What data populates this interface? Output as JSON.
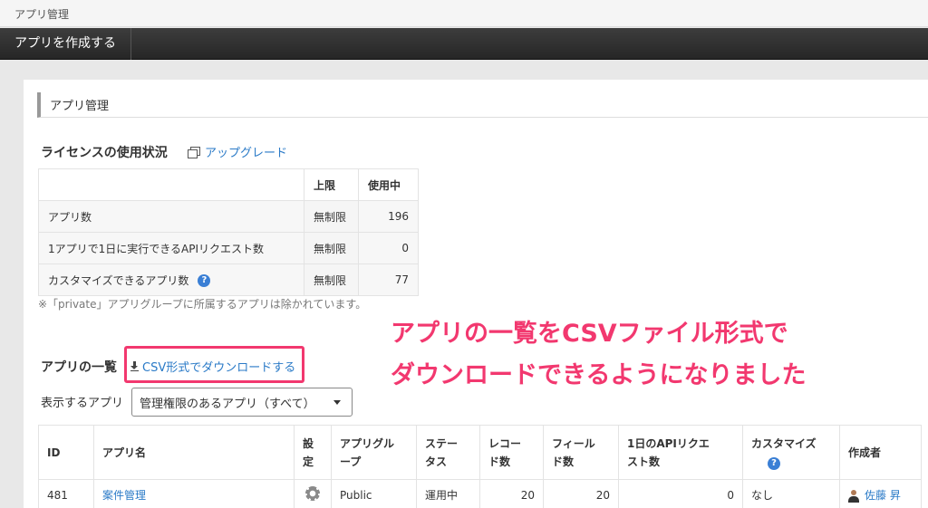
{
  "breadcrumb": {
    "text": "アプリ管理"
  },
  "toolbar": {
    "create_app_label": "アプリを作成する"
  },
  "section": {
    "title": "アプリ管理"
  },
  "license": {
    "title": "ライセンスの使用状況",
    "upgrade_label": "アップグレード",
    "header_limit": "上限",
    "header_used": "使用中",
    "rows": [
      {
        "label": "アプリ数",
        "limit": "無制限",
        "used": "196"
      },
      {
        "label": "1アプリで1日に実行できるAPIリクエスト数",
        "limit": "無制限",
        "used": "0"
      },
      {
        "label": "カスタマイズできるアプリ数",
        "limit": "無制限",
        "used": "77"
      }
    ],
    "note": "※「private」アプリグループに所属するアプリは除かれています。"
  },
  "annotation": {
    "line1": "アプリの一覧をCSVファイル形式で",
    "line2": "ダウンロードできるようになりました",
    "color": "#f2386f"
  },
  "apps": {
    "title": "アプリの一覧",
    "csv_download_label": "CSV形式でダウンロードする",
    "filter_label": "表示するアプリ",
    "filter_value": "管理権限のあるアプリ（すべて）",
    "columns": {
      "id": "ID",
      "name": "アプリ名",
      "settings": "設定",
      "group": "アプリグル\nープ",
      "status": "ステー\nタス",
      "records": "レコー\nド数",
      "fields": "フィール\nド数",
      "api": "1日のAPIリクエ\nスト数",
      "customize": "カスタマイズ",
      "creator": "作成者"
    },
    "rows": [
      {
        "id": "481",
        "name": "案件管理",
        "group": "Public",
        "status": "運用中",
        "records": "20",
        "fields": "20",
        "api": "0",
        "customize": "なし",
        "creator": "佐藤 昇"
      }
    ]
  }
}
